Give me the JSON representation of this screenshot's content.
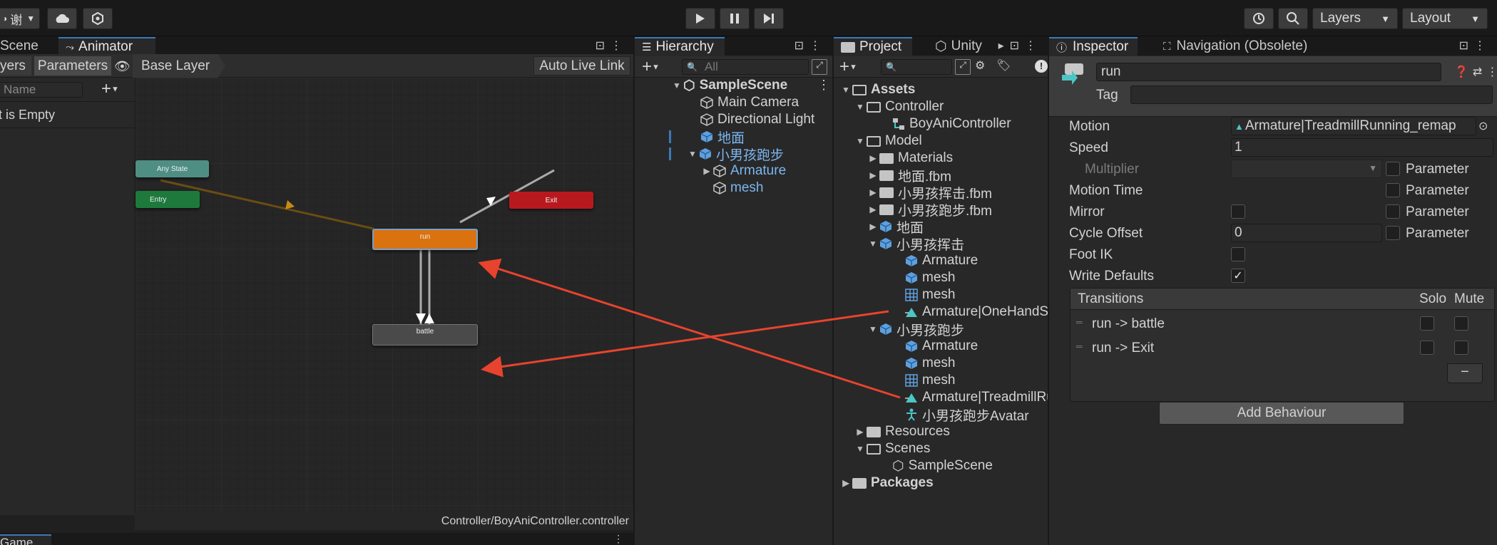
{
  "toolbar": {
    "account_label": "谢",
    "layers_label": "Layers",
    "layout_label": "Layout"
  },
  "animator": {
    "tabs": [
      "Scene",
      "Animator"
    ],
    "layers_tab": "yers",
    "parameters_tab": "Parameters",
    "breadcrumb": "Base Layer",
    "auto_live_link": "Auto Live Link",
    "search_placeholder": "Name",
    "empty_text": "t is Empty",
    "footer_path": "Controller/BoyAniController.controller",
    "states": {
      "any_state": "Any State",
      "entry": "Entry",
      "exit": "Exit",
      "run": "run",
      "battle": "battle"
    },
    "colors": {
      "any_state": "#4f8f83",
      "entry": "#1d7a3c",
      "exit": "#b8191f",
      "run": "#d9720f",
      "battle": "#4a4a4a",
      "annotation_arrow": "#e8432e"
    }
  },
  "game_tab": "Game",
  "hierarchy": {
    "tab": "Hierarchy",
    "search_placeholder": "All",
    "scene": "SampleScene",
    "items": [
      "Main Camera",
      "Directional Light",
      "地面",
      "小男孩跑步",
      "Armature",
      "mesh"
    ]
  },
  "project": {
    "tabs": [
      "Project",
      "Unity"
    ],
    "tree": {
      "assets": "Assets",
      "controller": "Controller",
      "boy_ani_controller": "BoyAniController",
      "model": "Model",
      "materials": "Materials",
      "ground_fbm": "地面.fbm",
      "boy_hit_fbm": "小男孩挥击.fbm",
      "boy_run_fbm": "小男孩跑步.fbm",
      "ground": "地面",
      "boy_hit": "小男孩挥击",
      "armature1": "Armature",
      "mesh1": "mesh",
      "mesh1b": "mesh",
      "anim1": "Armature|OneHandSv",
      "boy_run": "小男孩跑步",
      "armature2": "Armature",
      "mesh2": "mesh",
      "mesh2b": "mesh",
      "anim2": "Armature|TreadmillRu",
      "avatar": "小男孩跑步Avatar",
      "resources": "Resources",
      "scenes": "Scenes",
      "sample_scene": "SampleScene",
      "packages": "Packages"
    }
  },
  "inspector": {
    "tabs": [
      "Inspector",
      "Navigation (Obsolete)"
    ],
    "name_value": "run",
    "tag_label": "Tag",
    "motion_label": "Motion",
    "motion_value": "Armature|TreadmillRunning_remap",
    "speed_label": "Speed",
    "speed_value": "1",
    "multiplier_label": "Multiplier",
    "motion_time_label": "Motion Time",
    "mirror_label": "Mirror",
    "cycle_offset_label": "Cycle Offset",
    "cycle_offset_value": "0",
    "foot_ik_label": "Foot IK",
    "write_defaults_label": "Write Defaults",
    "parameter_label": "Parameter",
    "transitions_header": "Transitions",
    "solo_label": "Solo",
    "mute_label": "Mute",
    "transitions": [
      "run -> battle",
      "run -> Exit"
    ],
    "remove_label": "−",
    "add_behaviour": "Add Behaviour"
  }
}
